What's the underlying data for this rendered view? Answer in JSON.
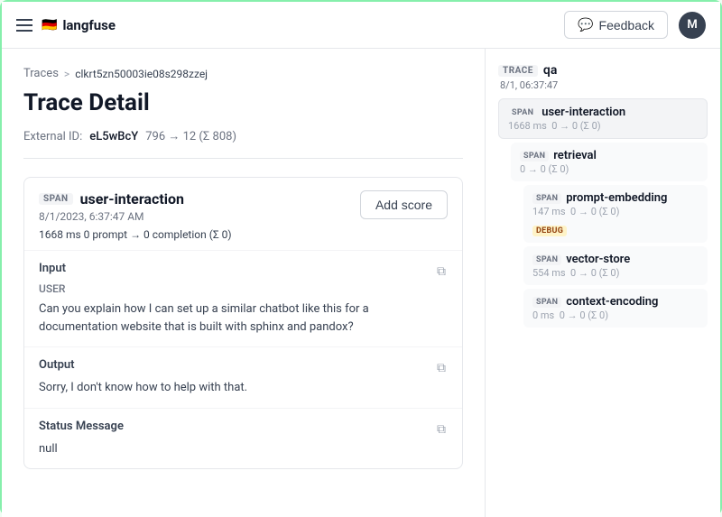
{
  "app": {
    "name": "langfuse",
    "logo": "🇩🇪"
  },
  "nav": {
    "hamburger_label": "Menu",
    "feedback_label": "Feedback",
    "avatar_label": "M"
  },
  "breadcrumb": {
    "parent": "Traces",
    "separator": ">",
    "current": "clkrt5zn50003ie08s298zzej"
  },
  "page": {
    "title": "Trace Detail",
    "external_id_label": "External ID:",
    "external_id_value": "eL5wBcY",
    "tokens_label": "796 → 12 (Σ 808)"
  },
  "span_card": {
    "badge": "SPAN",
    "name": "user-interaction",
    "timestamp": "8/1/2023, 6:37:47 AM",
    "stats": "1668 ms    0 prompt → 0 completion (Σ 0)",
    "add_score": "Add score",
    "input_label": "Input",
    "input_user_label": "USER",
    "input_text": "Can you explain how I can set up a similar chatbot like this for a documentation website that is built with sphinx and pandox?",
    "output_label": "Output",
    "output_text": "Sorry, I don't know how to help with that.",
    "status_label": "Status Message",
    "status_value": "null"
  },
  "right_panel": {
    "trace_badge": "TRACE",
    "trace_name": "qa",
    "trace_meta": "8/1, 06:37:47",
    "nodes": [
      {
        "badge": "SPAN",
        "name": "user-interaction",
        "meta": "1668 ms  0 → 0 (Σ 0)",
        "selected": true,
        "children": [
          {
            "badge": "SPAN",
            "name": "retrieval",
            "meta": "0 → 0 (Σ 0)",
            "selected": false,
            "children": [
              {
                "badge": "SPAN",
                "name": "prompt-embedding",
                "meta": "147 ms  0 → 0 (Σ 0)",
                "extra_badge": "DEBUG",
                "extra_badge_type": "debug",
                "selected": false,
                "children": []
              },
              {
                "badge": "SPAN",
                "name": "vector-store",
                "meta": "554 ms  0 → 0 (Σ 0)",
                "selected": false,
                "children": []
              },
              {
                "badge": "SPAN",
                "name": "context-encoding",
                "meta": "0 ms  0 → 0 (Σ 0)",
                "selected": false,
                "children": []
              }
            ]
          }
        ]
      }
    ]
  }
}
